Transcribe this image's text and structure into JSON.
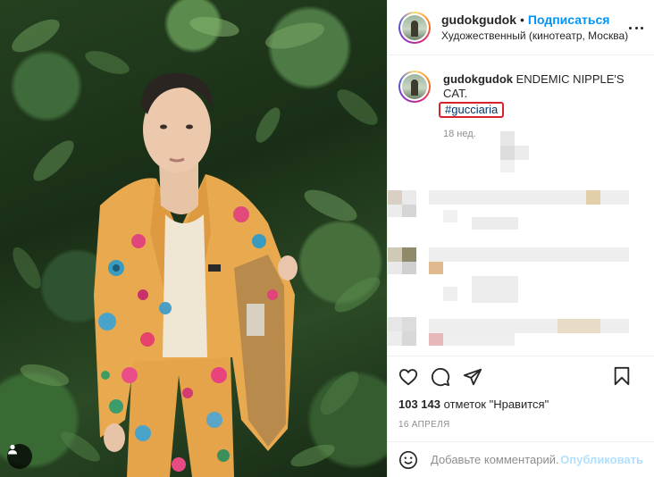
{
  "header": {
    "username": "gudokgudok",
    "separator": "•",
    "follow_label": "Подписаться",
    "location": "Художественный (кинотеатр, Москва)"
  },
  "caption": {
    "username": "gudokgudok",
    "text": "ENDEMIC NIPPLE'S CAT.",
    "hashtag": "#gucciaria",
    "age": "18 нед."
  },
  "likes": {
    "count": "103 143",
    "label": "отметок \"Нравится\""
  },
  "date": "16 АПРЕЛЯ",
  "comment_box": {
    "placeholder": "Добавьте комментарий...",
    "publish_label": "Опубликовать"
  },
  "icons": {
    "like": "heart-icon",
    "comment": "comment-icon",
    "share": "send-icon",
    "save": "bookmark-icon",
    "emoji": "smiley-icon",
    "more": "more-icon",
    "tagged": "user-icon"
  },
  "colors": {
    "accent": "#0095f6",
    "highlight_box": "#d8232a",
    "hashtag": "#00376b",
    "publish_disabled": "#b2dffc"
  }
}
